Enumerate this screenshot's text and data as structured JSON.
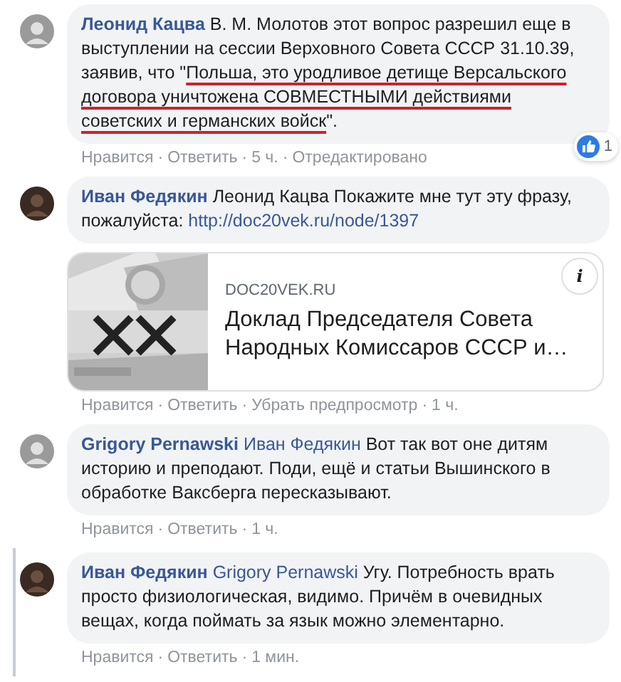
{
  "comments": [
    {
      "author": "Леонид Кацва",
      "threaded": false,
      "separator": "·",
      "body": [
        {
          "kind": "plain",
          "text": "В. М. Молотов этот вопрос разрешил еще в выступлении на сессии Верховного Совета СССР 31.10.39, заявив, что \""
        },
        {
          "kind": "underlined",
          "text": "Польша, это уродливое детище Версальского договора уничтожена СОВМЕСТНЫМИ действиями советских и германских войск"
        },
        {
          "kind": "plain",
          "text": "\"."
        }
      ],
      "reactions": {
        "count": "1"
      },
      "actions": [
        "Нравится",
        "Ответить",
        "5 ч.",
        "Отредактировано"
      ]
    },
    {
      "author": "Иван Федякин",
      "threaded": false,
      "separator": "·",
      "body": [
        {
          "kind": "plain",
          "text": "Леонид Кацва Покажите мне тут эту фразу, пожалуйста: "
        },
        {
          "kind": "link",
          "text": "http://doc20vek.ru/node/1397"
        }
      ],
      "preview": {
        "domain": "DOC20VEK.RU",
        "title": "Доклад Председателя Совета Народных Комиссаров СССР и…",
        "info": "i"
      },
      "actions": [
        "Нравится",
        "Ответить",
        "Убрать предпросмотр",
        "1 ч."
      ]
    },
    {
      "author": "Grigory Pernawski",
      "threaded": false,
      "separator": "·",
      "body": [
        {
          "kind": "mention",
          "text": "Иван Федякин"
        },
        {
          "kind": "plain",
          "text": " Вот так вот оне дитям историю и преподают. Поди, ещё и статьи Вышинского в обработке Ваксберга пересказывают."
        }
      ],
      "actions": [
        "Нравится",
        "Ответить",
        "1 ч."
      ]
    },
    {
      "author": "Иван Федякин",
      "threaded": true,
      "separator": "·",
      "body": [
        {
          "kind": "mention",
          "text": "Grigory Pernawski"
        },
        {
          "kind": "plain",
          "text": " Угу. Потребность врать просто физиологическая, видимо. Причём в очевидных вещах, когда поймать за язык можно элементарно."
        }
      ],
      "actions": [
        "Нравится",
        "Ответить",
        "1 мин."
      ]
    }
  ]
}
